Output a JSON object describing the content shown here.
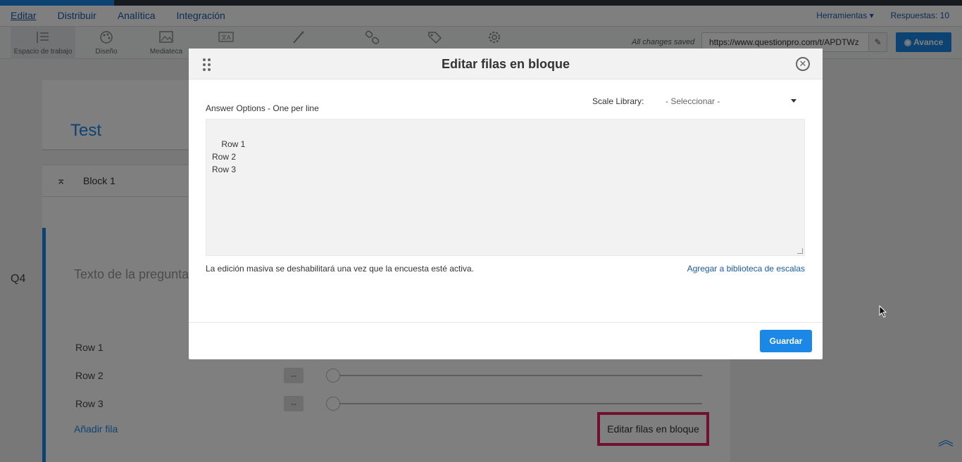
{
  "nav": {
    "tabs": [
      {
        "label": "Editar"
      },
      {
        "label": "Distribuir"
      },
      {
        "label": "Analítica"
      },
      {
        "label": "Integración"
      }
    ],
    "tools_menu": "Herramientas",
    "responses": "Respuestas: 10"
  },
  "toolbar": {
    "tools": [
      {
        "label": "Espacio de trabajo",
        "icon": "workspace-icon"
      },
      {
        "label": "Diseño",
        "icon": "palette-icon"
      },
      {
        "label": "Mediateca",
        "icon": "image-icon"
      },
      {
        "label": "",
        "icon": "translate-icon"
      },
      {
        "label": "",
        "icon": "magic-wand-icon"
      },
      {
        "label": "",
        "icon": "link-icon"
      },
      {
        "label": "",
        "icon": "tag-icon"
      },
      {
        "label": "",
        "icon": "gear-icon"
      }
    ],
    "saved_status": "All changes saved",
    "url": "https://www.questionpro.com/t/APDTWz",
    "preview_label": "Avance"
  },
  "survey": {
    "title": "Test",
    "block": "Block 1",
    "question_number": "Q4",
    "question_placeholder": "Texto de la pregunta",
    "rows": [
      "Row 1",
      "Row 2",
      "Row 3"
    ],
    "row_value": "--",
    "add_row": "Añadir fila",
    "bulk_edit": "Editar filas en bloque"
  },
  "modal": {
    "title": "Editar filas en bloque",
    "scale_library_label": "Scale Library:",
    "scale_library_value": "- Seleccionar -",
    "answer_options_label": "Answer Options - One per line",
    "answer_options_text": "Row 1\nRow 2\nRow 3",
    "note": "La edición masiva se deshabilitará una vez que la encuesta esté activa.",
    "add_to_library": "Agregar a biblioteca de escalas",
    "save_label": "Guardar"
  },
  "colors": {
    "accent": "#1b87e6",
    "highlight": "#e0245e"
  }
}
